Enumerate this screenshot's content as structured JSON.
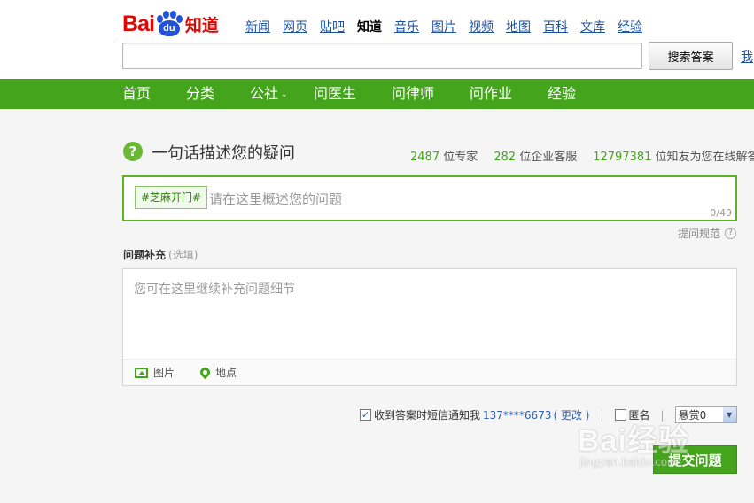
{
  "header": {
    "logo": {
      "bai": "Bai",
      "du": "du",
      "product": "知道"
    },
    "nav": [
      "新闻",
      "网页",
      "贴吧",
      "知道",
      "音乐",
      "图片",
      "视频",
      "地图",
      "百科",
      "文库",
      "经验"
    ],
    "nav_current": "知道",
    "search_value": "",
    "search_button": "搜索答案",
    "my_link": "我"
  },
  "green_nav": {
    "items": [
      "首页",
      "分类",
      "公社",
      "问医生",
      "问律师",
      "问作业",
      "经验"
    ]
  },
  "ask": {
    "title": "一句话描述您的疑问",
    "stats": {
      "experts_num": "2487",
      "experts_label": "位专家",
      "enterprise_num": "282",
      "enterprise_label": "位企业客服",
      "users_num": "12797381",
      "users_label": "位知友为您在线解答"
    },
    "tag": "#芝麻开门#",
    "placeholder": "请在这里概述您的问题",
    "counter": "0/49",
    "rules_link": "提问规范",
    "rules_icon": "?"
  },
  "supplement": {
    "label": "问题补充",
    "optional": "(选填)",
    "placeholder": "您可在这里继续补充问题细节",
    "tools": {
      "image": "图片",
      "location": "地点"
    }
  },
  "options": {
    "sms_checked": true,
    "sms_label": "收到答案时短信通知我",
    "phone": "137****6673",
    "change": "( 更改 )",
    "anon_checked": false,
    "anon_label": "匿名",
    "reward_value": "悬赏0",
    "sep": "|"
  },
  "submit_label": "提交问题",
  "watermark": {
    "logo": "Bai经验",
    "url": "jingyan.baidu.com"
  },
  "colors": {
    "brand_green": "#44a51c",
    "logo_red": "#e10601",
    "logo_blue": "#2152d8",
    "link_blue": "#1e4f9c"
  }
}
